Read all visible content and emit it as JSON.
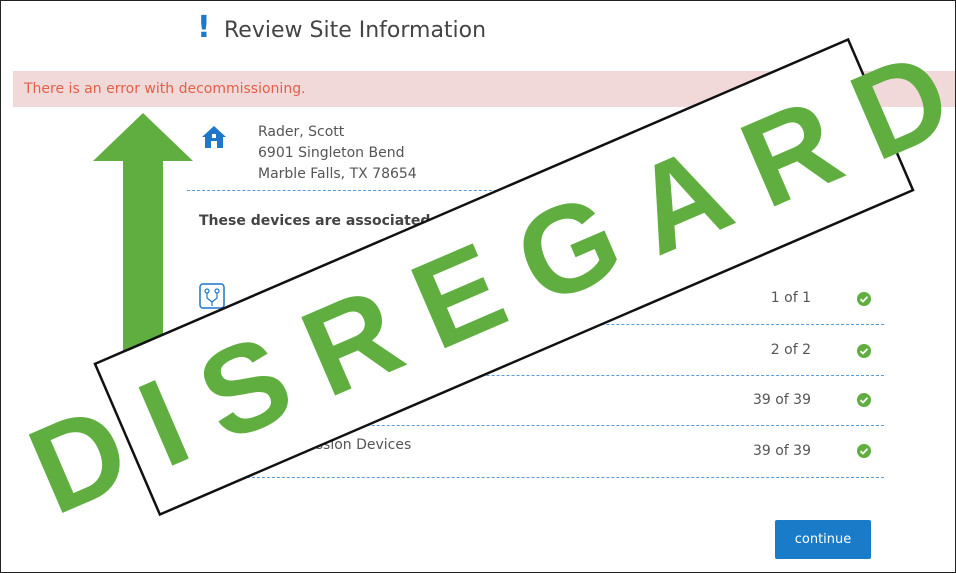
{
  "header": {
    "icon": "exclamation-icon",
    "title": "Review Site Information"
  },
  "error": {
    "message": "There is an error with decommissioning."
  },
  "site": {
    "icon": "home-icon",
    "name": "Rader, Scott",
    "street": "6901 Singleton Bend",
    "city_state_zip": "Marble Falls, TX 78654"
  },
  "devices_intro": "These devices are associated wit",
  "rows": [
    {
      "label": "",
      "count": "1 of 1",
      "status": "check-icon"
    },
    {
      "label": "",
      "count": "2 of 2",
      "status": "check-icon"
    },
    {
      "label": "",
      "count": "39 of 39",
      "status": "check-icon"
    },
    {
      "label": "ommission Devices",
      "count": "39 of 39",
      "status": "check-icon"
    }
  ],
  "actions": {
    "continue_label": "continue"
  },
  "overlay": {
    "stamp_text": "DISREGARD"
  },
  "colors": {
    "accent_blue": "#1a7cc9",
    "error_bg": "#f2d9d9",
    "error_text": "#e0604a",
    "stamp_green": "#5fae3f",
    "check_green": "#5fae3f"
  }
}
